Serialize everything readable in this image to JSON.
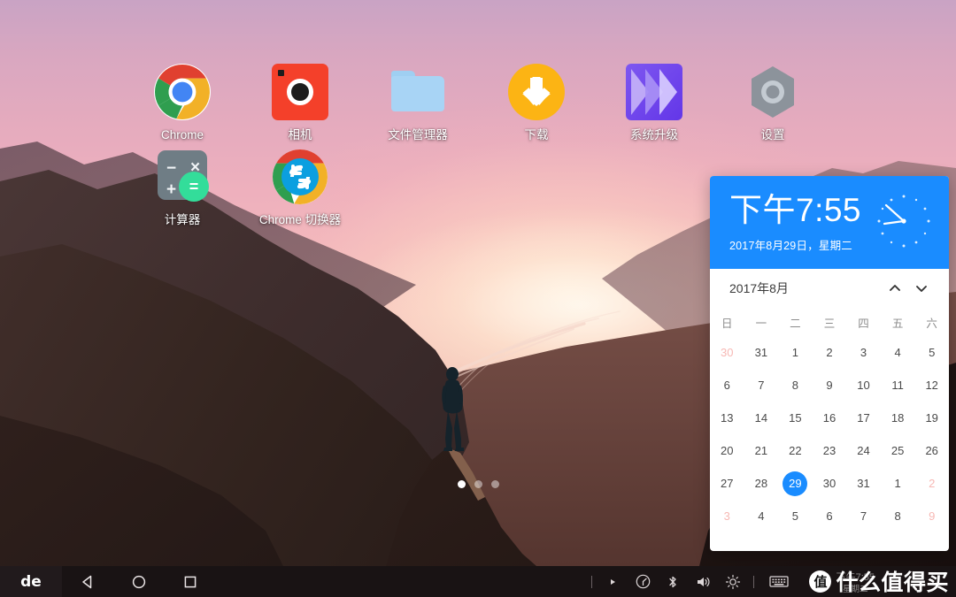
{
  "desktop": {
    "wallpaper_description": "sunset mountain valley with braided river and lone standing figure",
    "colors": {
      "sky_top": "#c9a3c4",
      "sky_mid": "#f2b8bd",
      "sun_glow": "#fff6e6",
      "mountain_dark": "#241916",
      "accent_blue": "#1a8cff",
      "weekend_red": "#ff5a52",
      "taskbar": "#191314"
    },
    "icons": [
      {
        "name": "chrome",
        "label": "Chrome",
        "icon": "chrome-icon"
      },
      {
        "name": "camera",
        "label": "相机",
        "icon": "camera-icon"
      },
      {
        "name": "file-manager",
        "label": "文件管理器",
        "icon": "folder-icon"
      },
      {
        "name": "downloads",
        "label": "下载",
        "icon": "download-arrow-icon"
      },
      {
        "name": "system-upgrade",
        "label": "系统升级",
        "icon": "double-chevron-icon"
      },
      {
        "name": "settings",
        "label": "设置",
        "icon": "gear-hex-icon"
      },
      {
        "name": "calculator",
        "label": "计算器",
        "icon": "calculator-icon"
      },
      {
        "name": "chrome-switcher",
        "label": "Chrome 切换器",
        "icon": "chrome-switch-icon"
      }
    ],
    "page_dots": {
      "count": 3,
      "active_index": 0
    }
  },
  "widget": {
    "time": "下午7:55",
    "date": "2017年8月29日，星期二",
    "clock_icon": "analog-clock-icon",
    "month_title": "2017年8月",
    "prev_label": "chevron-up-icon",
    "next_label": "chevron-down-icon",
    "weekdays": [
      "日",
      "一",
      "二",
      "三",
      "四",
      "五",
      "六"
    ],
    "weeks": [
      [
        {
          "d": "30",
          "muted": true
        },
        {
          "d": "31",
          "muted": true
        },
        {
          "d": "1"
        },
        {
          "d": "2"
        },
        {
          "d": "3"
        },
        {
          "d": "4"
        },
        {
          "d": "5"
        }
      ],
      [
        {
          "d": "6"
        },
        {
          "d": "7"
        },
        {
          "d": "8"
        },
        {
          "d": "9"
        },
        {
          "d": "10"
        },
        {
          "d": "11"
        },
        {
          "d": "12"
        }
      ],
      [
        {
          "d": "13"
        },
        {
          "d": "14"
        },
        {
          "d": "15"
        },
        {
          "d": "16"
        },
        {
          "d": "17"
        },
        {
          "d": "18"
        },
        {
          "d": "19"
        }
      ],
      [
        {
          "d": "20"
        },
        {
          "d": "21"
        },
        {
          "d": "22"
        },
        {
          "d": "23"
        },
        {
          "d": "24"
        },
        {
          "d": "25"
        },
        {
          "d": "26"
        }
      ],
      [
        {
          "d": "27"
        },
        {
          "d": "28"
        },
        {
          "d": "29",
          "today": true
        },
        {
          "d": "30"
        },
        {
          "d": "31"
        },
        {
          "d": "1",
          "muted": true
        },
        {
          "d": "2",
          "muted": true
        }
      ],
      [
        {
          "d": "3",
          "muted": true
        },
        {
          "d": "4",
          "muted": true
        },
        {
          "d": "5",
          "muted": true
        },
        {
          "d": "6",
          "muted": true
        },
        {
          "d": "7",
          "muted": true
        },
        {
          "d": "8",
          "muted": true
        },
        {
          "d": "9",
          "muted": true
        }
      ]
    ]
  },
  "taskbar": {
    "logo": "de",
    "nav": [
      {
        "name": "back",
        "icon": "back-triangle-icon"
      },
      {
        "name": "home",
        "icon": "home-circle-icon"
      },
      {
        "name": "recents",
        "icon": "recents-square-icon"
      }
    ],
    "status_icons": [
      {
        "name": "expand",
        "icon": "play-triangle-icon"
      },
      {
        "name": "performance",
        "icon": "gauge-circle-icon"
      },
      {
        "name": "bluetooth",
        "icon": "bluetooth-icon"
      },
      {
        "name": "volume",
        "icon": "volume-icon"
      },
      {
        "name": "brightness",
        "icon": "brightness-sun-icon"
      },
      {
        "name": "keyboard",
        "icon": "keyboard-icon"
      }
    ],
    "tray_clock": {
      "time": "下午7:55",
      "day": "星期二"
    }
  },
  "watermark": {
    "badge": "值",
    "text": "什么值得买"
  }
}
